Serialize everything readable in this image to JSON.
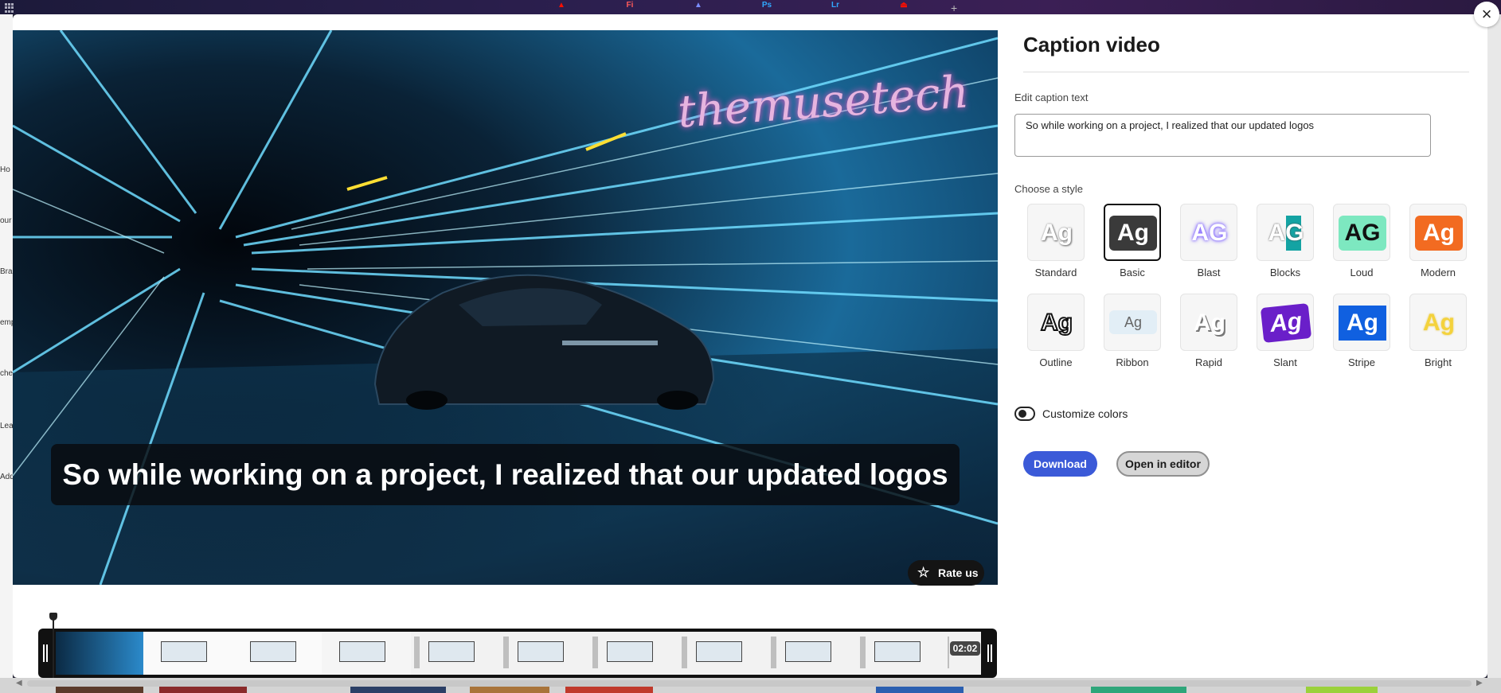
{
  "browser": {
    "app_icons": [
      {
        "glyph": "▲",
        "color": "#fa0f00",
        "name": "acrobat-icon"
      },
      {
        "glyph": "Fi",
        "color": "#ff5a5a",
        "name": "fresco-icon"
      },
      {
        "glyph": "▲",
        "color": "#7a8cff",
        "name": "express-icon"
      },
      {
        "glyph": "Ps",
        "color": "#31a8ff",
        "name": "photoshop-icon"
      },
      {
        "glyph": "Lr",
        "color": "#31a8ff",
        "name": "lightroom-icon"
      },
      {
        "glyph": "⏏",
        "color": "#fa0f00",
        "name": "acrobat-reader-icon"
      }
    ],
    "new_tab": "+"
  },
  "background_sidebar": [
    "Ho",
    "our",
    "Bra",
    "emp",
    "che",
    "Lea",
    "Add"
  ],
  "video": {
    "watermark": "themusetech",
    "caption": "So while working on a project, I realized that our updated logos",
    "rate_us": "Rate us"
  },
  "timeline": {
    "duration": "02:02"
  },
  "panel": {
    "title": "Caption video",
    "edit_caption_label": "Edit caption text",
    "caption_text": "So while working on a project, I realized that our updated logos",
    "choose_style_label": "Choose a style",
    "styles": [
      {
        "label": "Standard",
        "glyph": "Ag",
        "selected": false
      },
      {
        "label": "Basic",
        "glyph": "Ag",
        "selected": true
      },
      {
        "label": "Blast",
        "glyph": "AG",
        "selected": false
      },
      {
        "label": "Blocks",
        "glyph": "AG",
        "selected": false
      },
      {
        "label": "Loud",
        "glyph": "AG",
        "selected": false
      },
      {
        "label": "Modern",
        "glyph": "Ag",
        "selected": false
      },
      {
        "label": "Outline",
        "glyph": "Ag",
        "selected": false
      },
      {
        "label": "Ribbon",
        "glyph": "Ag",
        "selected": false
      },
      {
        "label": "Rapid",
        "glyph": "Ag",
        "selected": false
      },
      {
        "label": "Slant",
        "glyph": "Ag",
        "selected": false
      },
      {
        "label": "Stripe",
        "glyph": "Ag",
        "selected": false
      },
      {
        "label": "Bright",
        "glyph": "Ag",
        "selected": false
      }
    ],
    "customize_colors_label": "Customize colors",
    "customize_colors_on": false,
    "download_label": "Download",
    "open_in_editor_label": "Open in editor"
  },
  "colors": {
    "accent": "#3b5ad8",
    "caption_bg": "#080a0e"
  }
}
